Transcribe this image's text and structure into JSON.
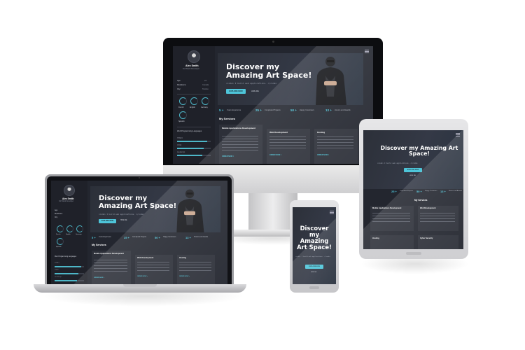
{
  "profile": {
    "name": "Alex Smith",
    "role": "Full Stack Developer",
    "info_labels": [
      "Age:",
      "Residence:",
      "City:"
    ],
    "info_values": [
      "24",
      "Canada",
      "Toronto"
    ],
    "languages": [
      "French",
      "English",
      "Germany"
    ],
    "extra_language": "Spanish",
    "skills_title": "Web Programming Languages",
    "skills": [
      {
        "name": "HTML5",
        "level": 0.9
      },
      {
        "name": "CSS3",
        "level": 0.8
      },
      {
        "name": "JavaScript",
        "level": 0.75
      }
    ]
  },
  "hero": {
    "title": "Discover my Amazing Art Space!",
    "code": "<code> I build web applications. </code>",
    "button": "EXPLORE NOW",
    "link": "HIRE ME"
  },
  "stats": [
    {
      "num": "5 +",
      "label": "Years Experience"
    },
    {
      "num": "25 +",
      "label": "Completed Projects"
    },
    {
      "num": "50 +",
      "label": "Happy Customers"
    },
    {
      "num": "13 +",
      "label": "Honors and Awards"
    }
  ],
  "services": {
    "title": "My Services",
    "cards": [
      {
        "title": "Mobile Applications Development",
        "link": "ORDER NOW >"
      },
      {
        "title": "Web Development",
        "link": "ORDER NOW >"
      },
      {
        "title": "Hosting",
        "link": "ORDER NOW >"
      }
    ],
    "tablet_cards": [
      {
        "title": "Mobile Applications Development"
      },
      {
        "title": "Web Development"
      },
      {
        "title": "Hosting"
      },
      {
        "title": "Cyber Security"
      }
    ]
  }
}
